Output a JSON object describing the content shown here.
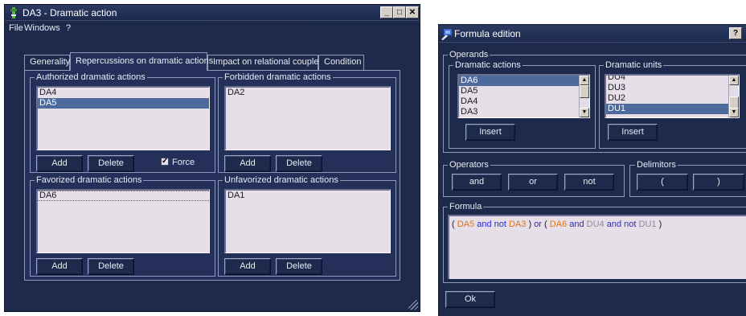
{
  "window1": {
    "title": "DA3 - Dramatic action",
    "title_buttons": {
      "minimize": "_",
      "maximize": "□",
      "close": "✕"
    },
    "menu": [
      "File",
      "Windows",
      "?"
    ],
    "tabs": [
      {
        "label": "Generality"
      },
      {
        "label": "Repercussions on dramatic actions"
      },
      {
        "label": "Impact on relational couples"
      },
      {
        "label": "Condition"
      }
    ],
    "authorized": {
      "legend": "Authorized dramatic actions",
      "items": [
        "DA4",
        "DA5"
      ],
      "selected": "DA5",
      "add": "Add",
      "delete": "Delete",
      "force_label": "Force"
    },
    "forbidden": {
      "legend": "Forbidden dramatic actions",
      "items": [
        "DA2"
      ],
      "add": "Add",
      "delete": "Delete"
    },
    "favorized": {
      "legend": "Favorized dramatic actions",
      "items": [
        "DA6"
      ],
      "add": "Add",
      "delete": "Delete"
    },
    "unfavorized": {
      "legend": "Unfavorized dramatic actions",
      "items": [
        "DA1"
      ],
      "add": "Add",
      "delete": "Delete"
    }
  },
  "window2": {
    "title": "Formula edition",
    "help_button": "?",
    "operands_legend": "Operands",
    "dramatic_actions": {
      "legend": "Dramatic actions",
      "items": [
        "DA6",
        "DA5",
        "DA4",
        "DA3"
      ],
      "selected": "DA6",
      "insert": "Insert"
    },
    "dramatic_units": {
      "legend": "Dramatic units",
      "items": [
        "DU4",
        "DU3",
        "DU2",
        "DU1"
      ],
      "selected": "DU1",
      "insert": "Insert"
    },
    "operators": {
      "legend": "Operators",
      "and": "and",
      "or": "or",
      "not": "not"
    },
    "delimitors": {
      "legend": "Delimitors",
      "open": "(",
      "close": ")"
    },
    "formula": {
      "legend": "Formula",
      "tokens": [
        {
          "t": "(",
          "k": "dl"
        },
        {
          "t": "DA5",
          "k": "da"
        },
        {
          "t": "and",
          "k": "op"
        },
        {
          "t": "not",
          "k": "op"
        },
        {
          "t": "DA3",
          "k": "da"
        },
        {
          "t": ")",
          "k": "dl"
        },
        {
          "t": "or",
          "k": "op"
        },
        {
          "t": "(",
          "k": "dl"
        },
        {
          "t": "DA6",
          "k": "da"
        },
        {
          "t": "and",
          "k": "op"
        },
        {
          "t": "DU4",
          "k": "du"
        },
        {
          "t": "and",
          "k": "op"
        },
        {
          "t": "not",
          "k": "op"
        },
        {
          "t": "DU1",
          "k": "du"
        },
        {
          "t": ")",
          "k": "dl"
        }
      ]
    },
    "ok": "Ok"
  },
  "colors": {
    "window_bg": "#1e2a4c",
    "list_bg": "#e7dfe7",
    "selection": "#4d6a9c",
    "dramatic_action_token": "#e0741a",
    "operator_token": "#2a2acf",
    "dramatic_unit_token": "#8a8aa0"
  }
}
